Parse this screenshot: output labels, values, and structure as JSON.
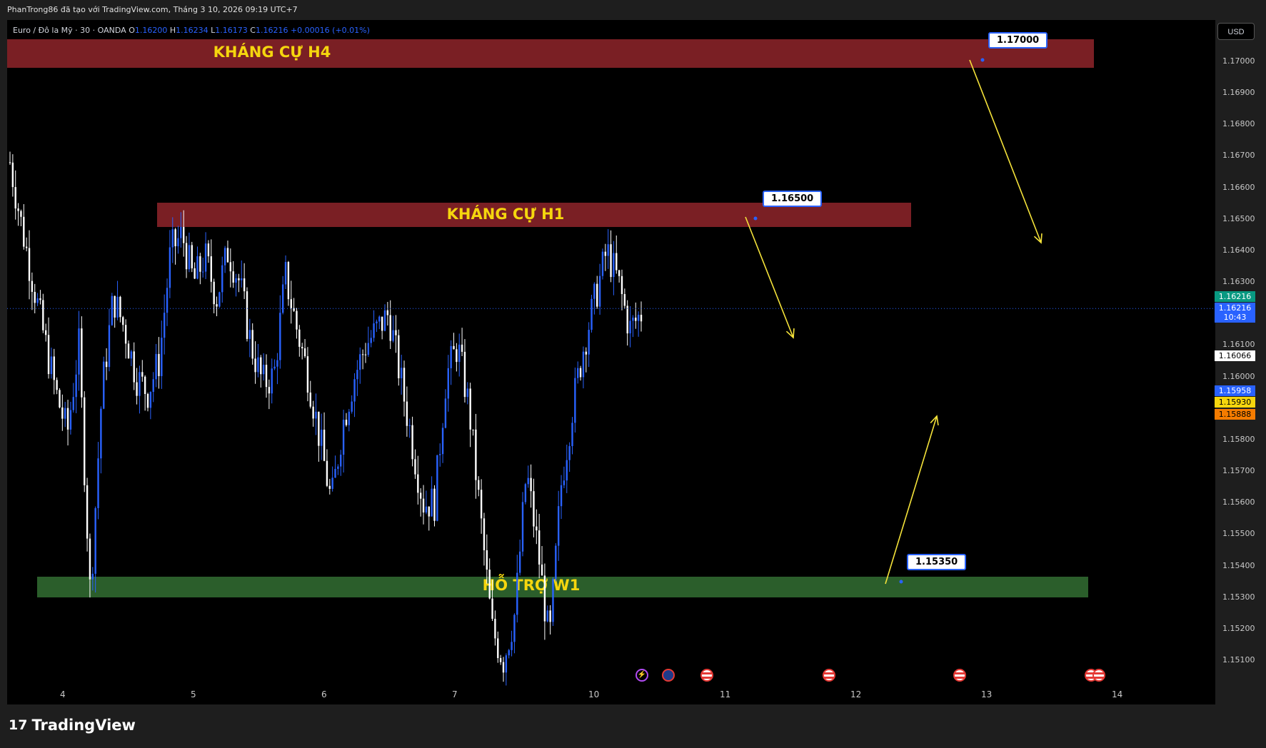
{
  "header": {
    "attribution": "PhanTrong86 đã tạo với TradingView.com, Tháng 3 10, 2026 09:19 UTC+7"
  },
  "legend": {
    "symbol": "Euro / Đô la Mỹ · 30 · OANDA",
    "o_label": "O",
    "o_value": "1.16200",
    "h_label": "H",
    "h_value": "1.16234",
    "l_label": "L",
    "l_value": "1.16173",
    "c_label": "C",
    "c_value": "1.16216",
    "change": "+0.00016 (+0.01%)"
  },
  "currency_button": "USD",
  "price_axis": {
    "ticks": [
      "1.17000",
      "1.16900",
      "1.16800",
      "1.16700",
      "1.16600",
      "1.16500",
      "1.16400",
      "1.16300",
      "1.16100",
      "1.16000",
      "1.15800",
      "1.15700",
      "1.15600",
      "1.15500",
      "1.15400",
      "1.15300",
      "1.15200",
      "1.15100"
    ],
    "tags": [
      {
        "value": "1.16216",
        "color": "#089981",
        "text_color": "#ffffff"
      },
      {
        "value": "1.16216",
        "extra": "10:43",
        "color": "#2962ff",
        "text_color": "#ffffff"
      },
      {
        "value": "1.16066",
        "color": "#ffffff",
        "text_color": "#000000"
      },
      {
        "value": "1.15958",
        "color": "#2962ff",
        "text_color": "#ffffff"
      },
      {
        "value": "1.15930",
        "color": "#f5d60e",
        "text_color": "#000000"
      },
      {
        "value": "1.15888",
        "color": "#f57c00",
        "text_color": "#000000"
      }
    ]
  },
  "time_axis": [
    "4",
    "5",
    "6",
    "7",
    "10",
    "11",
    "12",
    "13",
    "14"
  ],
  "zones": {
    "h4": {
      "label": "KHÁNG CỰ H4",
      "color": "#7a1f24"
    },
    "h1": {
      "label": "KHÁNG CỰ H1",
      "color": "#7a1f24"
    },
    "w1": {
      "label": "HỖ TRỢ W1",
      "color": "#2b5e2b"
    }
  },
  "callouts": {
    "h4": "1.17000",
    "h1": "1.16500",
    "w1": "1.15350"
  },
  "chart_data": {
    "type": "candlestick",
    "symbol": "Euro / Đô la Mỹ · 30 · OANDA",
    "ylim": [
      1.1505,
      1.1715
    ],
    "x_ticks": [
      "4",
      "5",
      "6",
      "7",
      "10",
      "11",
      "12",
      "13",
      "14"
    ],
    "zones": [
      {
        "label": "KHÁNG CỰ H4",
        "from": 1.1697,
        "to": 1.1706
      },
      {
        "label": "KHÁNG CỰ H1",
        "from": 1.1647,
        "to": 1.1654
      },
      {
        "label": "HỖ TRỢ W1",
        "from": 1.153,
        "to": 1.1536
      }
    ],
    "levels": [
      1.17,
      1.165,
      1.1535
    ],
    "last_price": 1.16216,
    "close_path": [
      1.1668,
      1.1648,
      1.163,
      1.1612,
      1.1595,
      1.1582,
      1.161,
      1.153,
      1.1595,
      1.1625,
      1.1615,
      1.16,
      1.1595,
      1.1605,
      1.164,
      1.1645,
      1.163,
      1.1638,
      1.1625,
      1.164,
      1.163,
      1.161,
      1.1598,
      1.16,
      1.1632,
      1.1615,
      1.16,
      1.158,
      1.156,
      1.1585,
      1.16,
      1.161,
      1.1615,
      1.162,
      1.16,
      1.158,
      1.156,
      1.156,
      1.16,
      1.161,
      1.159,
      1.1555,
      1.152,
      1.151,
      1.1525,
      1.157,
      1.1545,
      1.1515,
      1.1565,
      1.159,
      1.161,
      1.1625,
      1.164,
      1.163,
      1.1615,
      1.162
    ]
  }
}
